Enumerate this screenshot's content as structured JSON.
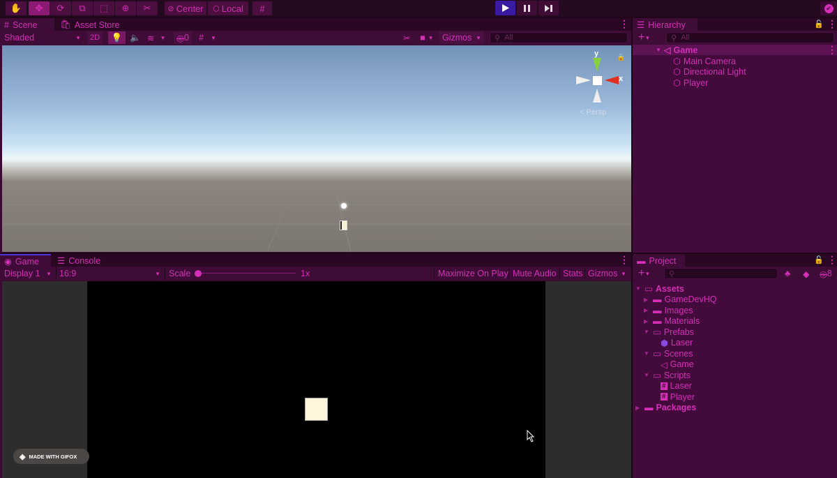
{
  "toolbar": {
    "tools": [
      "hand-tool",
      "move-tool",
      "rotate-tool",
      "scale-tool",
      "rect-tool",
      "transform-tool",
      "custom-tool"
    ],
    "pivot_label": "Center",
    "space_label": "Local",
    "active_tool": "move-tool"
  },
  "scene": {
    "tabs": [
      "Scene",
      "Asset Store"
    ],
    "shading": "Shaded",
    "mode_2d": "2D",
    "hidden_count": "0",
    "gizmos_label": "Gizmos",
    "search_placeholder": "All",
    "gizmo_axes": {
      "y": "y",
      "x": "x"
    },
    "projection": "Persp"
  },
  "game": {
    "tabs": [
      "Game",
      "Console"
    ],
    "display": "Display 1",
    "aspect": "16:9",
    "scale_label": "Scale",
    "scale_value": "1x",
    "buttons": [
      "Maximize On Play",
      "Mute Audio",
      "Stats",
      "Gizmos"
    ]
  },
  "hierarchy": {
    "title": "Hierarchy",
    "search_placeholder": "All",
    "scene_name": "Game",
    "objects": [
      "Main Camera",
      "Directional Light",
      "Player"
    ]
  },
  "project": {
    "title": "Project",
    "hidden_count": "8",
    "tree": [
      {
        "label": "Assets",
        "depth": 0,
        "expanded": true,
        "type": "folder-open",
        "bold": true
      },
      {
        "label": "GameDevHQ",
        "depth": 1,
        "expanded": false,
        "type": "folder"
      },
      {
        "label": "Images",
        "depth": 1,
        "expanded": false,
        "type": "folder"
      },
      {
        "label": "Materials",
        "depth": 1,
        "expanded": false,
        "type": "folder"
      },
      {
        "label": "Prefabs",
        "depth": 1,
        "expanded": true,
        "type": "folder-open"
      },
      {
        "label": "Laser",
        "depth": 2,
        "type": "prefab"
      },
      {
        "label": "Scenes",
        "depth": 1,
        "expanded": true,
        "type": "folder-open"
      },
      {
        "label": "Game",
        "depth": 2,
        "type": "scene"
      },
      {
        "label": "Scripts",
        "depth": 1,
        "expanded": true,
        "type": "folder-open"
      },
      {
        "label": "Laser",
        "depth": 2,
        "type": "script"
      },
      {
        "label": "Player",
        "depth": 2,
        "type": "script"
      },
      {
        "label": "Packages",
        "depth": 0,
        "expanded": false,
        "type": "folder",
        "bold": true
      }
    ]
  },
  "watermark": "MADE WITH GIFOX",
  "colors": {
    "accent": "#d42fb6",
    "panel": "#3a0a33",
    "play_active": "#3a1aa0"
  }
}
